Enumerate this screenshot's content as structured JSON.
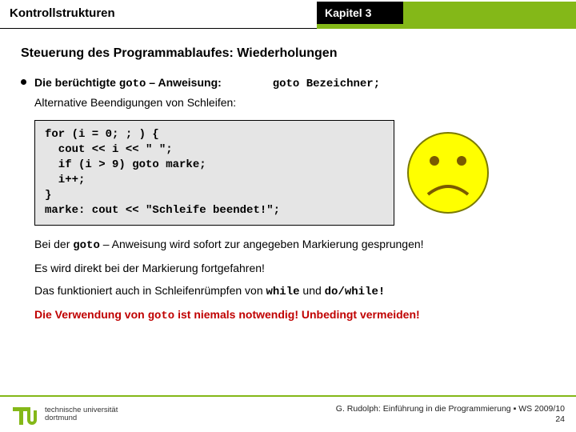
{
  "header": {
    "title": "Kontrollstrukturen",
    "chapter": "Kapitel 3"
  },
  "subtitle": "Steuerung des Programmablaufes: Wiederholungen",
  "bullet": {
    "line1_part1": "Die berüchtigte ",
    "line1_mono": "goto",
    "line1_part2": " – Anweisung:",
    "syntax_mono1": "goto",
    "syntax_rest": " Bezeichner;",
    "alt": "Alternative Beendigungen von Schleifen:"
  },
  "code": "for (i = 0; ; ) {\n  cout << i << \" \";\n  if (i > 9) goto marke;\n  i++;\n}\nmarke: cout << \"Schleife beendet!\";",
  "para1_a": "Bei der ",
  "para1_mono": "goto",
  "para1_b": " – Anweisung wird sofort zur angegeben Markierung gesprungen!",
  "para2": "Es wird direkt bei der Markierung fortgefahren!",
  "para3_a": "Das funktioniert auch in Schleifenrümpfen von ",
  "para3_mono1": "while",
  "para3_mid": " und ",
  "para3_mono2": "do/while!",
  "warn_a": "Die Verwendung von ",
  "warn_mono": "goto",
  "warn_b": " ist niemals notwendig! Unbedingt vermeiden!",
  "footer": {
    "uni1": "technische universität",
    "uni2": "dortmund",
    "course": "G. Rudolph: Einführung in die Programmierung ▪ WS 2009/10",
    "page": "24"
  }
}
